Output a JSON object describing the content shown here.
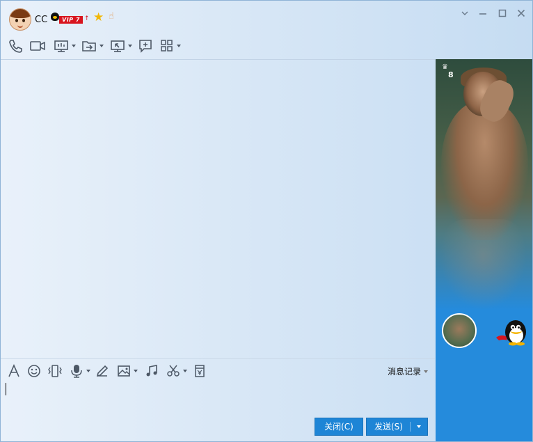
{
  "window": {
    "user": {
      "nickname": "CC",
      "vip_label": "VIP 7",
      "up_arrow": "↑"
    },
    "controls": [
      "minimize-caret",
      "minimize",
      "maximize",
      "close"
    ]
  },
  "toolbar": {
    "icons": [
      "phone-icon",
      "video-icon",
      "screen-share-icon",
      "file-transfer-icon",
      "remote-desktop-icon",
      "message-add-icon",
      "apps-icon"
    ]
  },
  "input_toolbar": {
    "icons": [
      "font-icon",
      "emoji-icon",
      "shake-icon",
      "voice-icon",
      "pen-icon",
      "image-icon",
      "music-icon",
      "scissors-icon",
      "red-packet-icon"
    ],
    "history_label": "消息记录"
  },
  "actions": {
    "close_label": "关闭(C)",
    "send_label": "发送(S)"
  },
  "side_panel": {
    "level": "8"
  },
  "colors": {
    "accent": "#1e85d6",
    "panel": "#258bdc",
    "vip_red": "#d8151f"
  }
}
